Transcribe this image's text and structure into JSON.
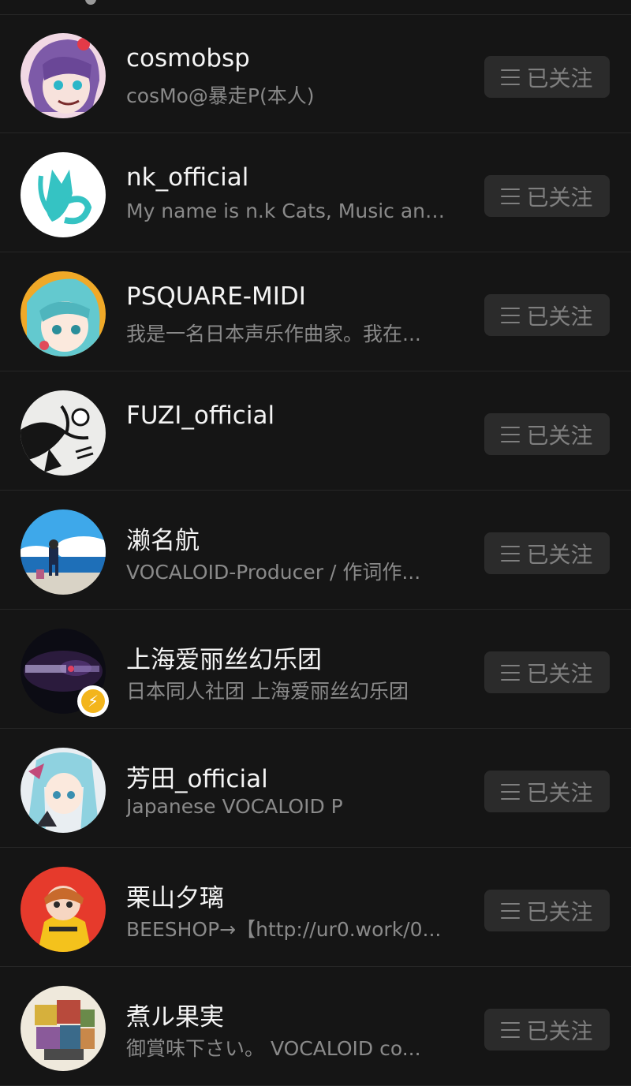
{
  "follow_list": {
    "follow_button_label": "已关注",
    "accent_badge_color": "#f3b51c",
    "items": [
      {
        "name": "cosmobsp",
        "desc": "cosMo@暴走P(本人)"
      },
      {
        "name": "nk_official",
        "desc": "My name is n.k Cats, Music and..."
      },
      {
        "name": "PSQUARE-MIDI",
        "desc": "我是一名日本声乐作曲家。我在..."
      },
      {
        "name": "FUZI_official",
        "desc": ""
      },
      {
        "name": "濑名航",
        "desc": "VOCALOID-Producer / 作词作..."
      },
      {
        "name": "上海爱丽丝幻乐团",
        "desc": "日本同人社团 上海爱丽丝幻乐团",
        "has_badge": true,
        "badge_icon": "lightning-icon"
      },
      {
        "name": "芳田_official",
        "desc": "Japanese VOCALOID P"
      },
      {
        "name": "栗山夕璃",
        "desc": "BEESHOP→【http://ur0.work/0..."
      },
      {
        "name": "煮ル果実",
        "desc": "御賞味下さい。 VOCALOID co..."
      }
    ]
  }
}
